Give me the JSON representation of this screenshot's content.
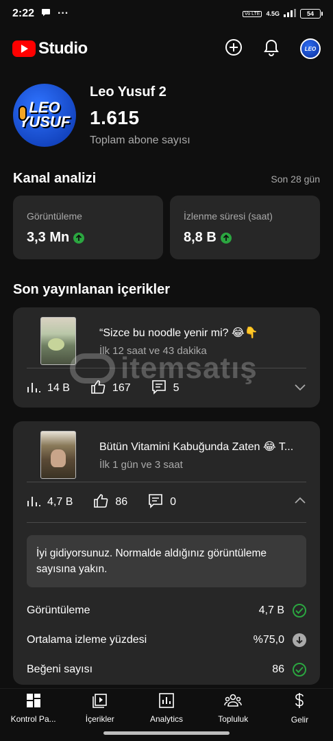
{
  "status_bar": {
    "time": "2:22",
    "overflow": "···",
    "network": "4.5G",
    "volte": "Vo LTE",
    "battery": "54"
  },
  "app": {
    "logo_text": "Studio"
  },
  "channel": {
    "name": "Leo Yusuf 2",
    "subscribers": "1.615",
    "subscribers_label": "Toplam abone sayısı",
    "avatar_line1": "LEO",
    "avatar_line2": "YUSUF"
  },
  "analytics": {
    "title": "Kanal analizi",
    "period": "Son 28 gün",
    "metrics": [
      {
        "label": "Görüntüleme",
        "value": "3,3 Mn",
        "trend": "up"
      },
      {
        "label": "İzlenme süresi (saat)",
        "value": "8,8 B",
        "trend": "up"
      }
    ]
  },
  "recent": {
    "title": "Son yayınlanan içerikler",
    "videos": [
      {
        "title": "“Sizce bu noodle yenir mi? 😂👇",
        "subtitle": "İlk 12 saat ve 43 dakika",
        "views": "14 B",
        "likes": "167",
        "comments": "5",
        "expanded": false
      },
      {
        "title": "Bütün Vitamini Kabuğunda Zaten 😂 T...",
        "subtitle": "İlk 1 gün ve 3 saat",
        "views": "4,7 B",
        "likes": "86",
        "comments": "0",
        "expanded": true,
        "note": "İyi gidiyorsunuz. Normalde aldığınız görüntüleme sayısına yakın.",
        "details": [
          {
            "label": "Görüntüleme",
            "value": "4,7 B",
            "status": "check"
          },
          {
            "label": "Ortalama izleme yüzdesi",
            "value": "%75,0",
            "status": "down"
          },
          {
            "label": "Beğeni sayısı",
            "value": "86",
            "status": "check"
          }
        ]
      }
    ]
  },
  "watermark": "itemsatış",
  "bottom_nav": [
    {
      "label": "Kontrol Pa...",
      "icon": "dashboard-icon"
    },
    {
      "label": "İçerikler",
      "icon": "content-icon"
    },
    {
      "label": "Analytics",
      "icon": "analytics-icon"
    },
    {
      "label": "Topluluk",
      "icon": "community-icon"
    },
    {
      "label": "Gelir",
      "icon": "earn-icon"
    }
  ],
  "colors": {
    "background": "#0f0f0f",
    "card": "#272727",
    "accent_red": "#ff0000",
    "success": "#2ba640"
  }
}
